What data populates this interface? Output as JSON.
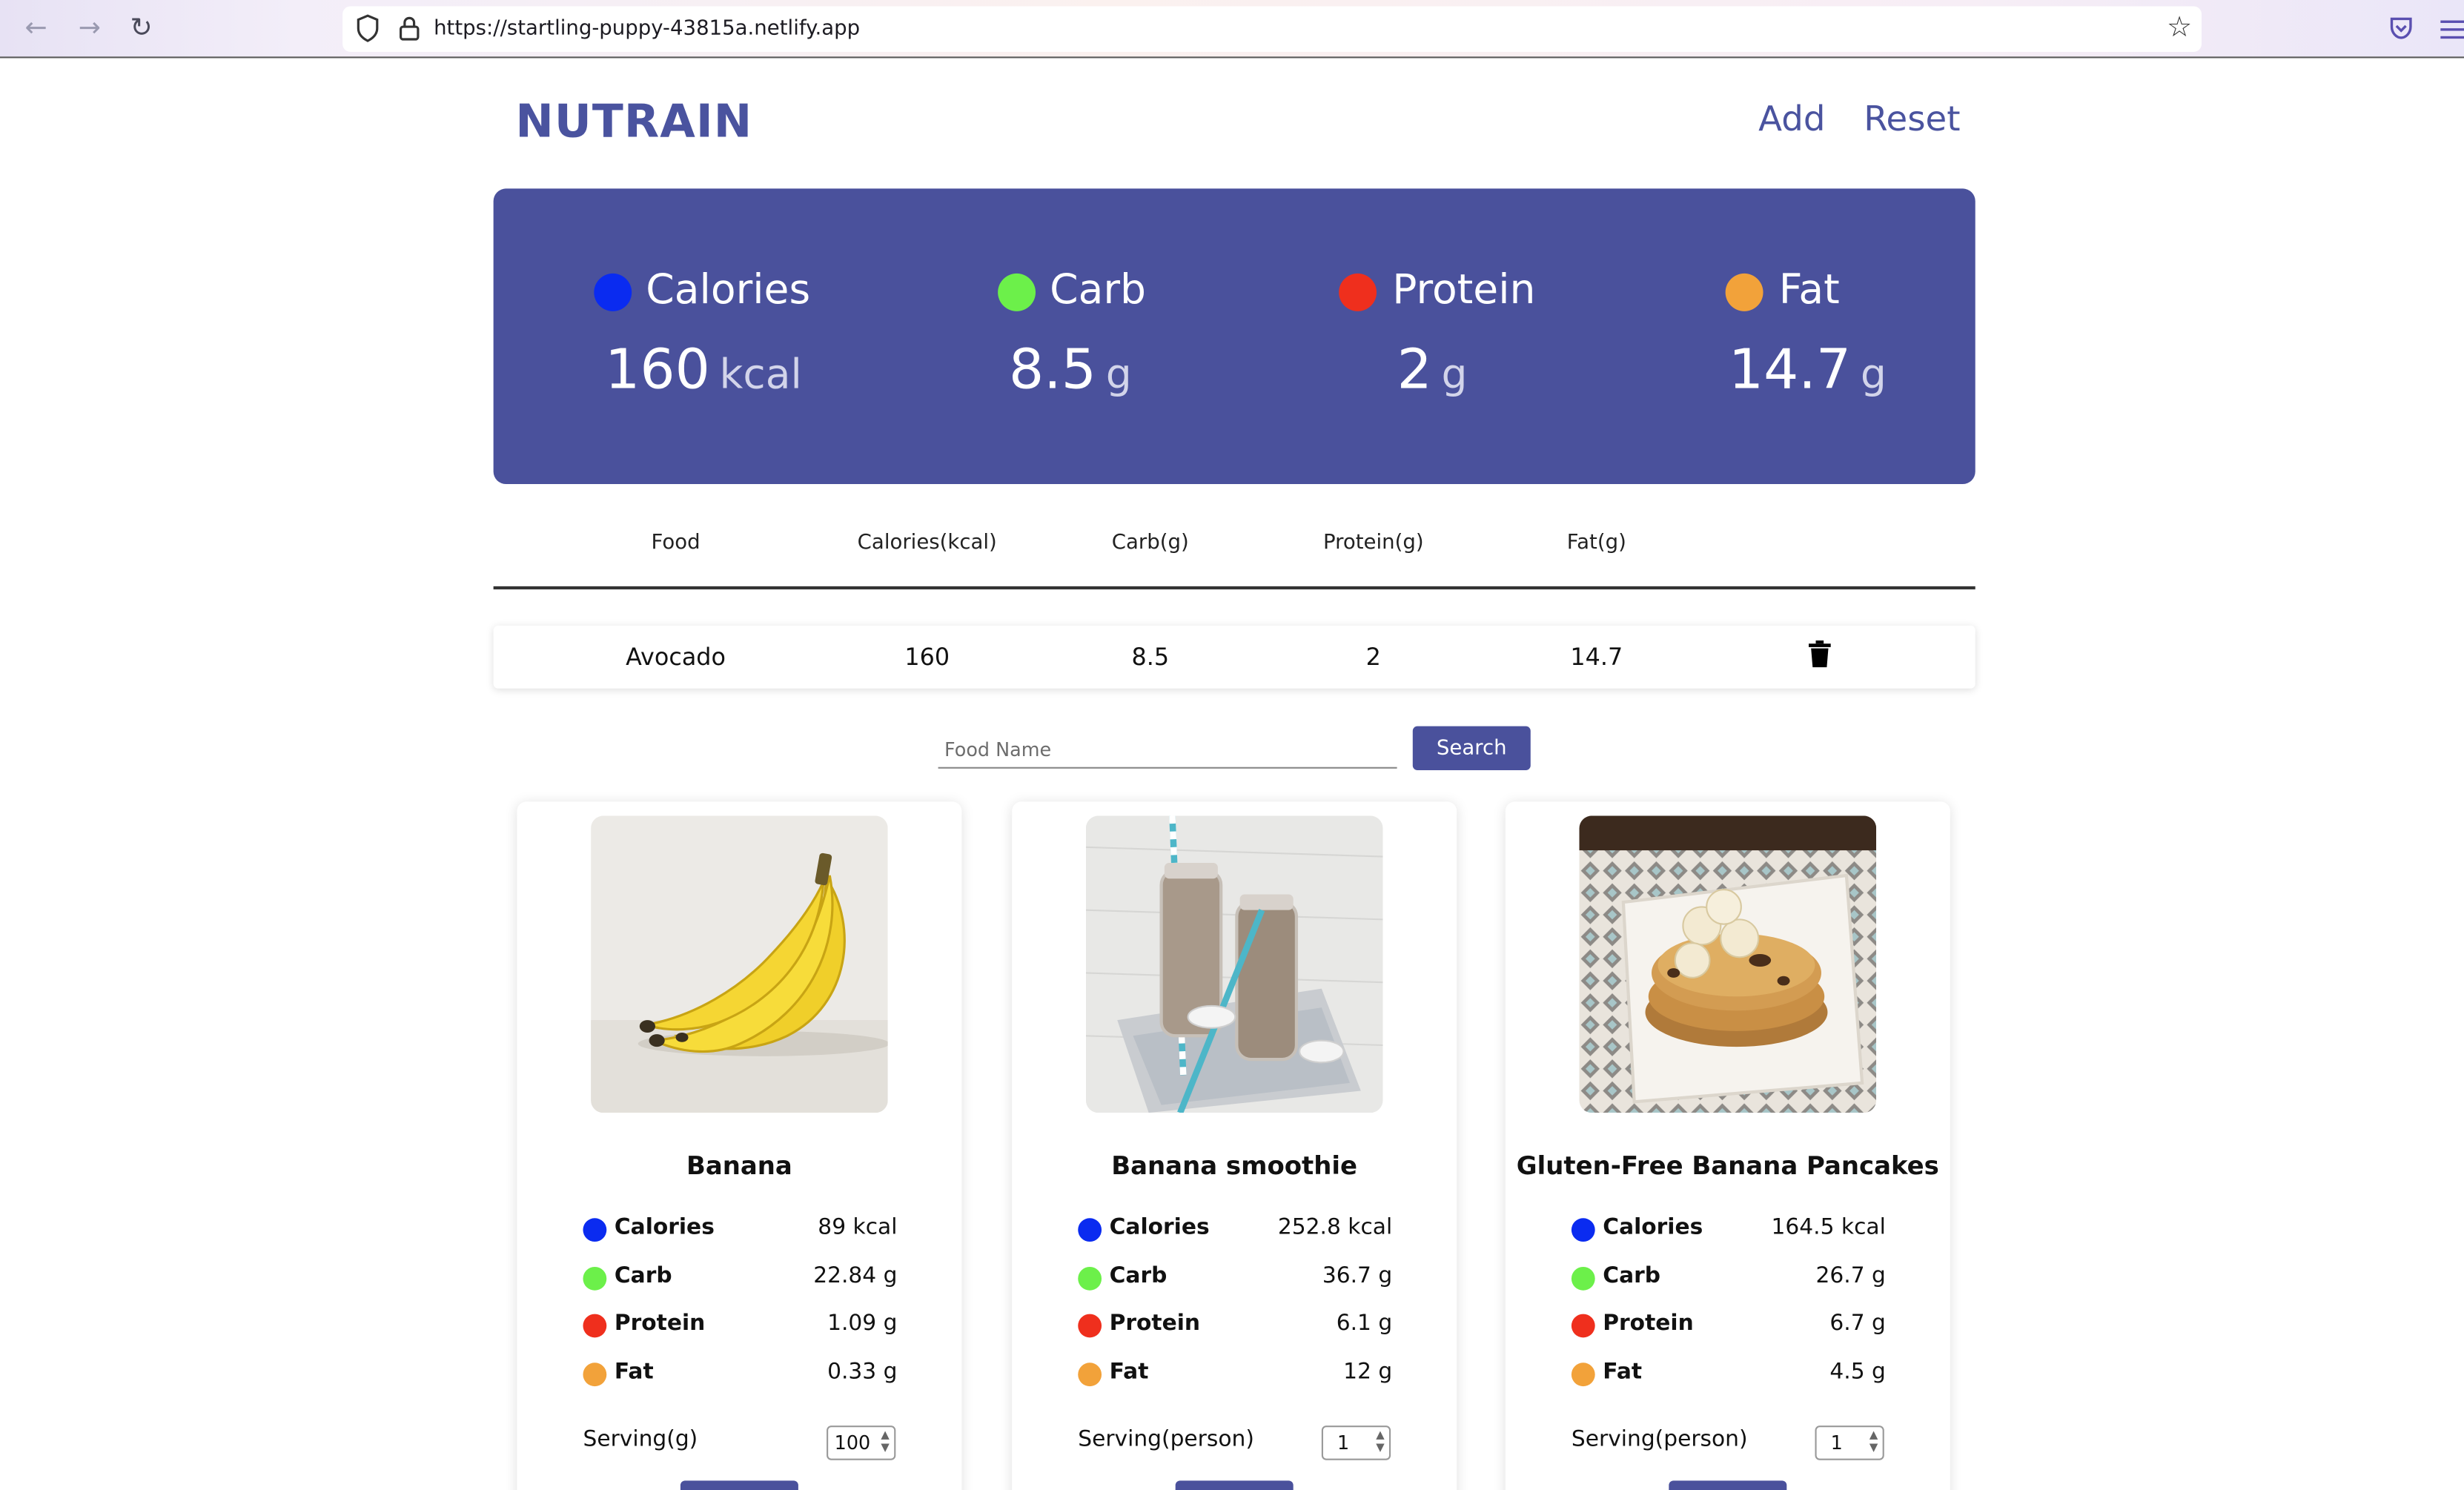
{
  "browser": {
    "url": "https://startling-puppy-43815a.netlify.app"
  },
  "app": {
    "brand": "NUTRAIN",
    "nav": {
      "add": "Add",
      "reset": "Reset"
    }
  },
  "colors": {
    "primary": "#4a519c",
    "calories": "#0a2bf0",
    "carb": "#6cf04a",
    "protein": "#ef2f1d",
    "fat": "#f2a23a"
  },
  "summary": [
    {
      "label": "Calories",
      "value": "160",
      "unit": "kcal"
    },
    {
      "label": "Carb",
      "value": "8.5",
      "unit": "g"
    },
    {
      "label": "Protein",
      "value": "2",
      "unit": "g"
    },
    {
      "label": "Fat",
      "value": "14.7",
      "unit": "g"
    }
  ],
  "table": {
    "headers": [
      "Food",
      "Calories(kcal)",
      "Carb(g)",
      "Protein(g)",
      "Fat(g)"
    ],
    "rows": [
      {
        "food": "Avocado",
        "calories": "160",
        "carb": "8.5",
        "protein": "2",
        "fat": "14.7",
        "action_icon": "trash-icon"
      }
    ]
  },
  "search": {
    "placeholder": "Food Name",
    "value": "",
    "button_label": "Search"
  },
  "cards": [
    {
      "title": "Banana",
      "image": "banana-photo",
      "nutrients": [
        {
          "label": "Calories",
          "value": "89 kcal"
        },
        {
          "label": "Carb",
          "value": "22.84 g"
        },
        {
          "label": "Protein",
          "value": "1.09 g"
        },
        {
          "label": "Fat",
          "value": "0.33 g"
        }
      ],
      "serving_label": "Serving(g)",
      "serving_value": "100"
    },
    {
      "title": "Banana smoothie",
      "image": "smoothie-photo",
      "nutrients": [
        {
          "label": "Calories",
          "value": "252.8 kcal"
        },
        {
          "label": "Carb",
          "value": "36.7 g"
        },
        {
          "label": "Protein",
          "value": "6.1 g"
        },
        {
          "label": "Fat",
          "value": "12 g"
        }
      ],
      "serving_label": "Serving(person)",
      "serving_value": "1"
    },
    {
      "title": "Gluten-Free Banana Pancakes",
      "image": "pancakes-photo",
      "nutrients": [
        {
          "label": "Calories",
          "value": "164.5 kcal"
        },
        {
          "label": "Carb",
          "value": "26.7 g"
        },
        {
          "label": "Protein",
          "value": "6.7 g"
        },
        {
          "label": "Fat",
          "value": "4.5 g"
        }
      ],
      "serving_label": "Serving(person)",
      "serving_value": "1"
    }
  ]
}
